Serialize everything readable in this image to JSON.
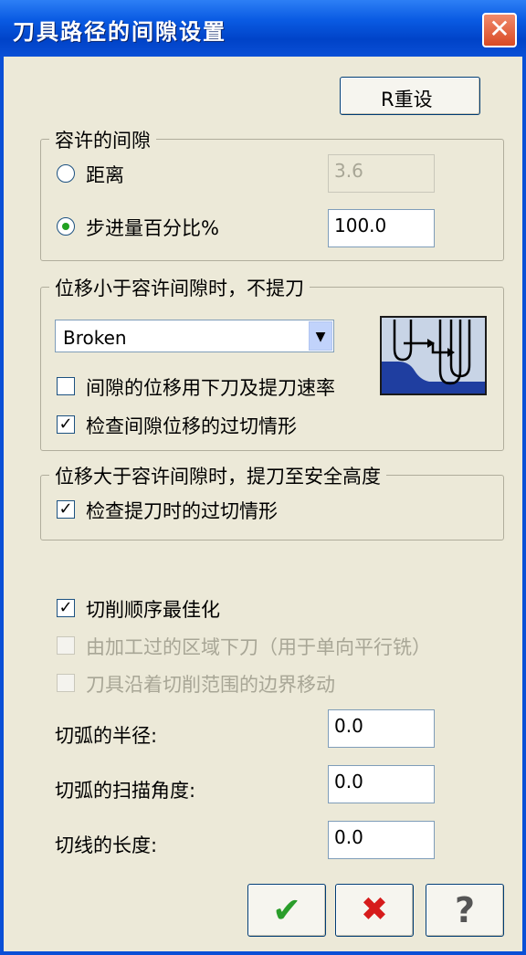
{
  "window": {
    "title": "刀具路径的间隙设置",
    "close_glyph": "✕"
  },
  "reset_button": {
    "label": "R重设"
  },
  "tolerance_group": {
    "legend": "容许的间隙",
    "distance_label": "距离",
    "distance_value": "3.6",
    "stepover_label": "步进量百分比%",
    "stepover_value": "100.0",
    "selected": "stepover"
  },
  "small_move_group": {
    "legend": "位移小于容许间隙时，不提刀",
    "mode_value": "Broken",
    "plunge_rate_label": "间隙的位移用下刀及提刀速率",
    "plunge_rate_checked": false,
    "gouge_check_label": "检查间隙位移的过切情形",
    "gouge_check_checked": true
  },
  "large_move_group": {
    "legend": "位移大于容许间隙时，提刀至安全高度",
    "retract_gouge_label": "检查提刀时的过切情形",
    "retract_gouge_checked": true
  },
  "options": {
    "optimize_label": "切削顺序最佳化",
    "optimize_checked": true,
    "plunge_machined_label": "由加工过的区域下刀（用于单向平行铣）",
    "plunge_machined_checked": false,
    "follow_boundary_label": "刀具沿着切削范围的边界移动",
    "follow_boundary_checked": false
  },
  "fields": {
    "arc_radius_label": "切弧的半径:",
    "arc_radius_value": "0.0",
    "arc_sweep_label": "切弧的扫描角度:",
    "arc_sweep_value": "0.0",
    "line_length_label": "切线的长度:",
    "line_length_value": "0.0"
  },
  "buttons": {
    "ok_glyph": "✔",
    "cancel_glyph": "✖",
    "help_glyph": "?"
  },
  "colors": {
    "ok": "#2a9d2a",
    "cancel": "#d61b1b",
    "titlebar": "#0a5be3"
  }
}
